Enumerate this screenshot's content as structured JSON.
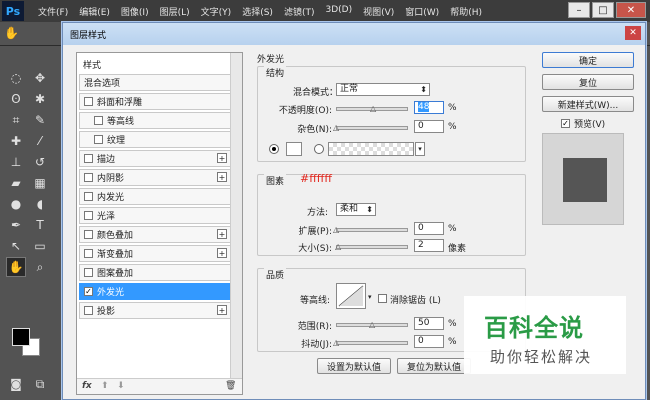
{
  "app": {
    "logo": "Ps",
    "menu": [
      "文件(F)",
      "编辑(E)",
      "图像(I)",
      "图层(L)",
      "文字(Y)",
      "选择(S)",
      "滤镜(T)",
      "3D(D)",
      "视图(V)",
      "窗口(W)",
      "帮助(H)"
    ],
    "window_controls": [
      "–",
      "□",
      "✕"
    ]
  },
  "dialog": {
    "title": "图层样式",
    "close": "✕",
    "style_list": {
      "header": "样式",
      "blend": "混合选项",
      "items": [
        {
          "label": "斜面和浮雕",
          "checked": false
        },
        {
          "label": "等高线",
          "checked": false,
          "sub": true
        },
        {
          "label": "纹理",
          "checked": false,
          "sub": true
        },
        {
          "label": "描边",
          "checked": false,
          "plus": true
        },
        {
          "label": "内阴影",
          "checked": false,
          "plus": true
        },
        {
          "label": "内发光",
          "checked": false
        },
        {
          "label": "光泽",
          "checked": false
        },
        {
          "label": "颜色叠加",
          "checked": false,
          "plus": true
        },
        {
          "label": "渐变叠加",
          "checked": false,
          "plus": true
        },
        {
          "label": "图案叠加",
          "checked": false
        },
        {
          "label": "外发光",
          "checked": true,
          "selected": true
        },
        {
          "label": "投影",
          "checked": false,
          "plus": true
        }
      ],
      "footer": {
        "fx": "fx",
        "up": "⬆",
        "down": "⬇",
        "trash": "🗑"
      }
    },
    "outer_glow": {
      "title": "外发光",
      "structure": {
        "label": "结构",
        "blend_mode_label": "混合模式：",
        "blend_mode": "正常",
        "opacity_label": "不透明度(O):",
        "opacity": "48",
        "opacity_unit": "%",
        "noise_label": "杂色(N):",
        "noise": "0",
        "noise_unit": "%"
      },
      "elements": {
        "label": "图素",
        "color_hex": "#ffffff",
        "method_label": "方法:",
        "method": "柔和",
        "spread_label": "扩展(P):",
        "spread": "0",
        "spread_unit": "%",
        "size_label": "大小(S):",
        "size": "2",
        "size_unit": "像素"
      },
      "quality": {
        "label": "品质",
        "contour_label": "等高线:",
        "antialias_label": "消除锯齿 (L)",
        "range_label": "范围(R):",
        "range": "50",
        "range_unit": "%",
        "jitter_label": "抖动(J):",
        "jitter": "0",
        "jitter_unit": "%"
      },
      "set_default": "设置为默认值",
      "reset_default": "复位为默认值"
    },
    "buttons": {
      "ok": "确定",
      "reset": "复位",
      "new_style": "新建样式(W)...",
      "preview_label": "预览(V)"
    }
  },
  "watermark": {
    "line1": "百科全说",
    "line2": "助你轻松解决"
  }
}
